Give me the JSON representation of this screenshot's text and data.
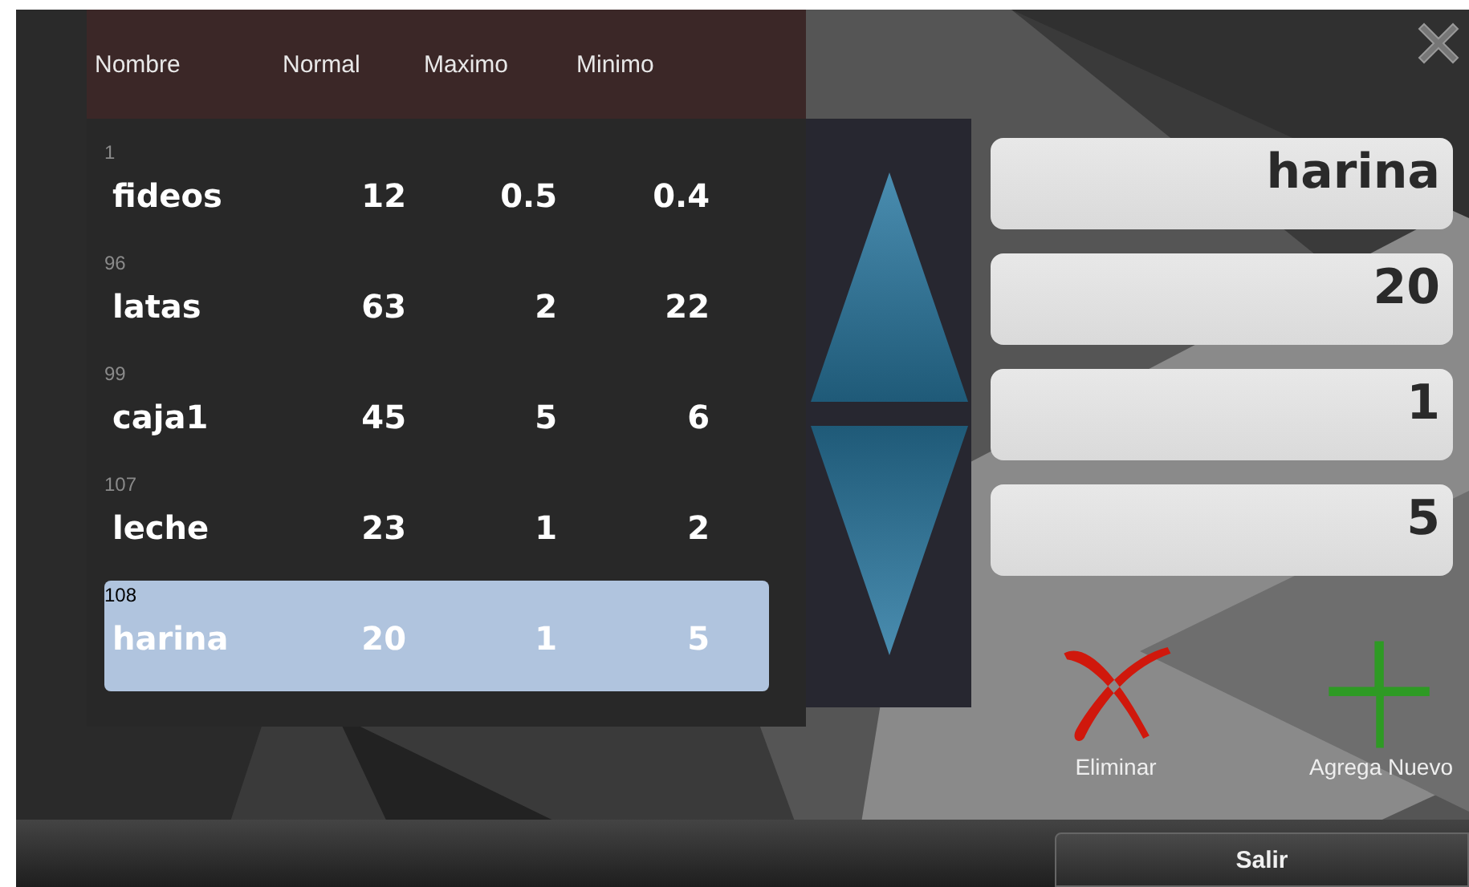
{
  "table": {
    "columns": [
      "Nombre",
      "Normal",
      "Maximo",
      "Minimo"
    ],
    "rows": [
      {
        "id": "1",
        "name": "fideos",
        "normal": "12",
        "maximo": "0.5",
        "minimo": "0.4",
        "selected": false
      },
      {
        "id": "96",
        "name": "latas",
        "normal": "63",
        "maximo": "2",
        "minimo": "22",
        "selected": false
      },
      {
        "id": "99",
        "name": "caja1",
        "normal": "45",
        "maximo": "5",
        "minimo": "6",
        "selected": false
      },
      {
        "id": "107",
        "name": "leche",
        "normal": "23",
        "maximo": "1",
        "minimo": "2",
        "selected": false
      },
      {
        "id": "108",
        "name": "harina",
        "normal": "20",
        "maximo": "1",
        "minimo": "5",
        "selected": true
      }
    ]
  },
  "fields": [
    {
      "value": "harina"
    },
    {
      "value": "20"
    },
    {
      "value": "1"
    },
    {
      "value": "5"
    }
  ],
  "actions": [
    {
      "kind": "delete",
      "label": "Eliminar"
    },
    {
      "kind": "add",
      "label": "Agrega Nuevo"
    }
  ],
  "exit_button": "Salir"
}
